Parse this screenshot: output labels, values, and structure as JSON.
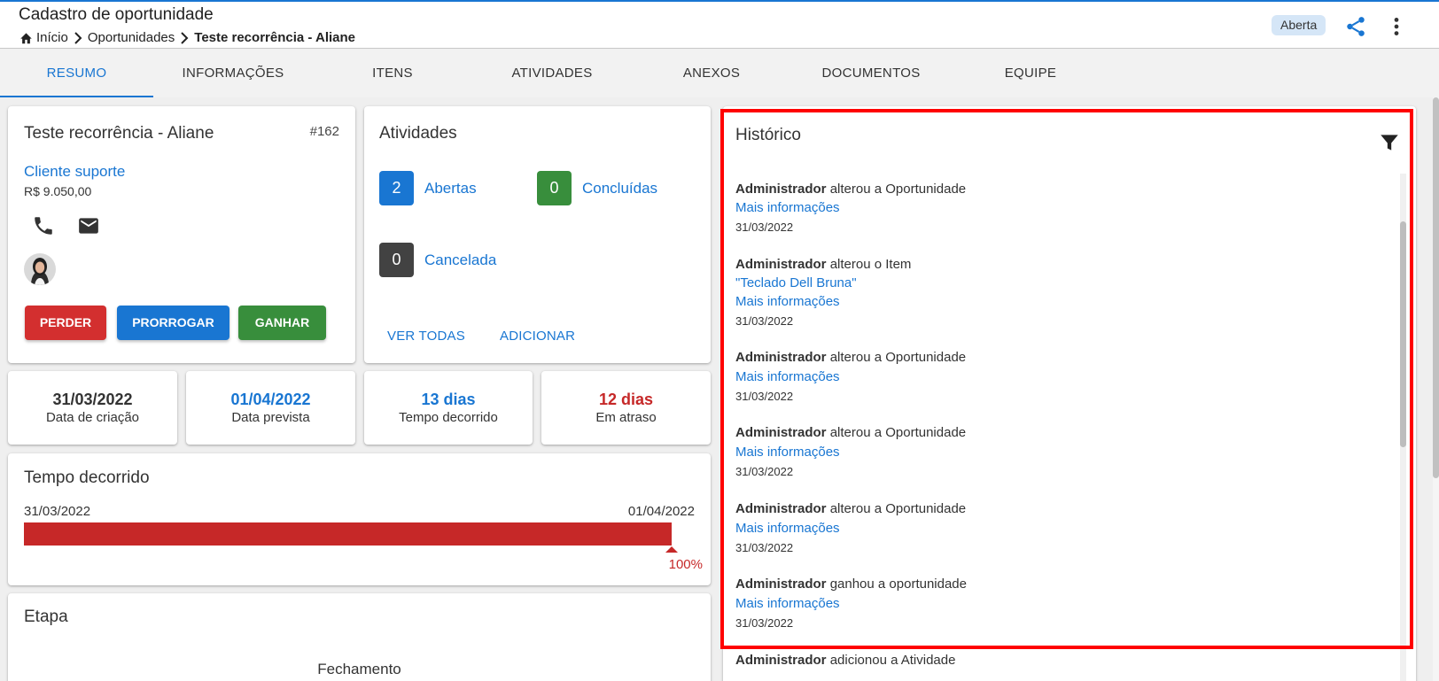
{
  "header": {
    "title": "Cadastro de oportunidade",
    "breadcrumb": [
      "Início",
      "Oportunidades",
      "Teste recorrência - Aliane"
    ],
    "status": "Aberta"
  },
  "tabs": [
    "RESUMO",
    "INFORMAÇÕES",
    "ITENS",
    "ATIVIDADES",
    "ANEXOS",
    "DOCUMENTOS",
    "EQUIPE"
  ],
  "opportunity": {
    "name": "Teste recorrência - Aliane",
    "number": "#162",
    "client": "Cliente suporte",
    "value": "R$ 9.050,00",
    "actions": {
      "lose": "PERDER",
      "extend": "PRORROGAR",
      "win": "GANHAR"
    }
  },
  "activities": {
    "title": "Atividades",
    "open_count": "2",
    "open_label": "Abertas",
    "done_count": "0",
    "done_label": "Concluídas",
    "cancel_count": "0",
    "cancel_label": "Cancelada",
    "view_all": "VER TODAS",
    "add": "ADICIONAR"
  },
  "stats": [
    {
      "value": "31/03/2022",
      "label": "Data de criação",
      "color": "#333333"
    },
    {
      "value": "01/04/2022",
      "label": "Data prevista",
      "color": "#1976d2"
    },
    {
      "value": "13 dias",
      "label": "Tempo decorrido",
      "color": "#1976d2"
    },
    {
      "value": "12 dias",
      "label": "Em atraso",
      "color": "#c62828"
    }
  ],
  "elapsed": {
    "title": "Tempo decorrido",
    "start": "31/03/2022",
    "end": "01/04/2022",
    "progress": 1.0,
    "progress_label": "100%"
  },
  "stage": {
    "title": "Etapa",
    "current": "Fechamento"
  },
  "history": {
    "title": "Histórico",
    "more_label": "Mais informações",
    "entries": [
      {
        "user": "Administrador",
        "action": "alterou a Oportunidade",
        "detail": "",
        "date": "31/03/2022"
      },
      {
        "user": "Administrador",
        "action": "alterou o Item",
        "detail": "\"Teclado Dell Bruna\"",
        "date": "31/03/2022"
      },
      {
        "user": "Administrador",
        "action": "alterou a Oportunidade",
        "detail": "",
        "date": "31/03/2022"
      },
      {
        "user": "Administrador",
        "action": "alterou a Oportunidade",
        "detail": "",
        "date": "31/03/2022"
      },
      {
        "user": "Administrador",
        "action": "alterou a Oportunidade",
        "detail": "",
        "date": "31/03/2022"
      },
      {
        "user": "Administrador",
        "action": "ganhou a oportunidade",
        "detail": "",
        "date": "31/03/2022"
      },
      {
        "user": "Administrador",
        "action": "adicionou a Atividade",
        "detail": "",
        "date": ""
      }
    ]
  },
  "colors": {
    "accent": "#1976d2",
    "danger": "#d32f2f",
    "success": "#388e3c",
    "dark": "#424242",
    "highlight": "#ff0000"
  },
  "icons": [
    "home-icon",
    "chevron-right-icon",
    "share-icon",
    "more-vert-icon",
    "phone-icon",
    "email-icon",
    "filter-icon"
  ]
}
